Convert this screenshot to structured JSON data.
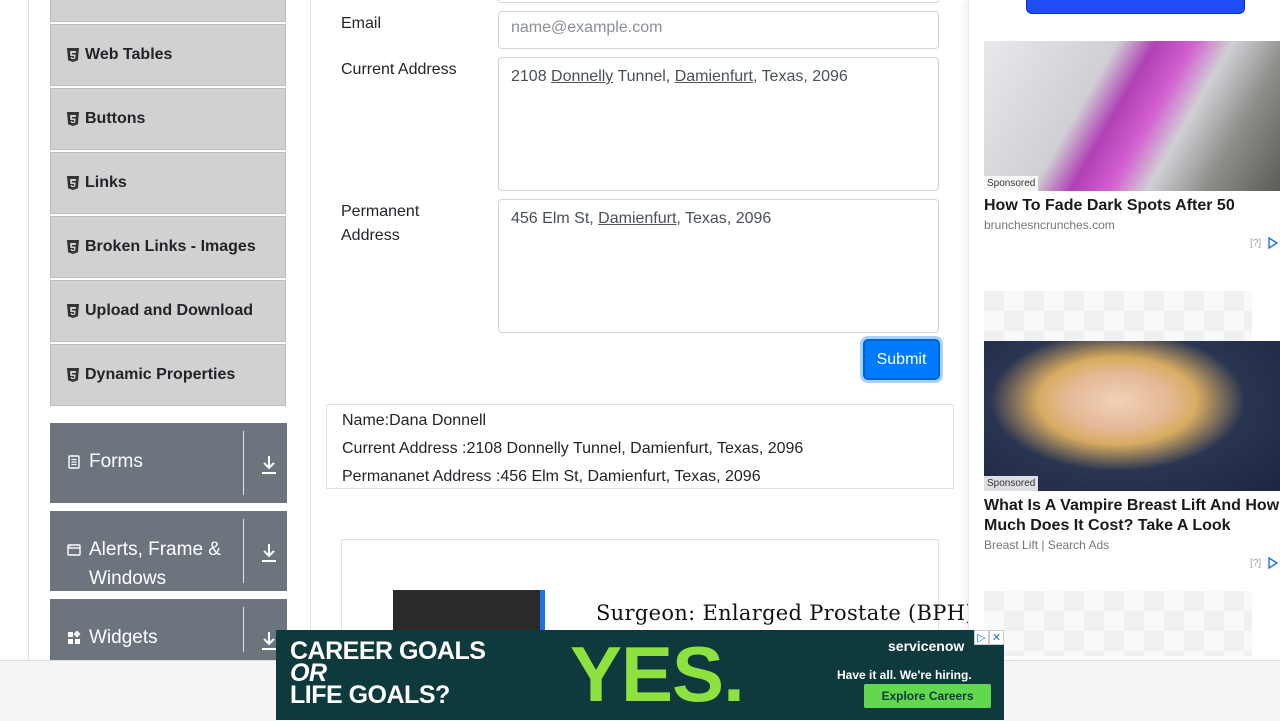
{
  "sidebar": {
    "items": [
      {
        "label": "Web Tables",
        "icon": "html5-icon"
      },
      {
        "label": "Buttons",
        "icon": "html5-icon"
      },
      {
        "label": "Links",
        "icon": "html5-icon"
      },
      {
        "label": "Broken Links - Images",
        "icon": "html5-icon"
      },
      {
        "label": "Upload and Download",
        "icon": "html5-icon"
      },
      {
        "label": "Dynamic Properties",
        "icon": "html5-icon"
      }
    ],
    "groups": [
      {
        "label": "Forms",
        "icon": "document-icon"
      },
      {
        "label": "Alerts, Frame & Windows",
        "icon": "window-icon"
      },
      {
        "label": "Widgets",
        "icon": "widgets-icon"
      }
    ]
  },
  "form": {
    "email_label": "Email",
    "email_placeholder": "name@example.com",
    "current_address_label": "Current Address",
    "current_address_value": {
      "p1": "2108 ",
      "p2": "Donnelly",
      "p3": " Tunnel, ",
      "p4": "Damienfurt",
      "p5": ", Texas, 2096"
    },
    "permanent_address_label": "Permanent Address",
    "permanent_address_value": {
      "p1": "456 Elm St, ",
      "p2": "Damienfurt",
      "p3": ", Texas, 2096"
    },
    "submit_label": "Submit"
  },
  "output": {
    "name": "Name:Dana Donnell",
    "current_address": "Current Address :2108 Donnelly Tunnel, Damienfurt, Texas, 2096",
    "permanent_address": "Permananet Address :456 Elm St, Damienfurt, Texas, 2096"
  },
  "inline_ad": {
    "headline": "Surgeon: Enlarged Prostate (BPH)? I"
  },
  "right_ads": [
    {
      "sponsored": "Sponsored",
      "title": "How To Fade Dark Spots After 50",
      "source": "brunchesncrunches.com",
      "info": "[?]"
    },
    {
      "sponsored": "Sponsored",
      "title": "What Is A Vampire Breast Lift And How Much Does It Cost? Take A Look",
      "source": "Breast Lift | Search Ads",
      "info": "[?]"
    }
  ],
  "banner": {
    "line1": "CAREER GOALS",
    "line2": "OR",
    "line3": "LIFE GOALS?",
    "big": "YES.",
    "brand": "servicenow",
    "tagline": "Have it all. We're hiring.",
    "cta": "Explore Careers"
  },
  "colors": {
    "primary": "#007bff",
    "group_bg": "#6c757d",
    "menu_bg": "#d1d1d1",
    "banner_bg": "#0f3a3d",
    "banner_accent": "#8ee23f"
  }
}
